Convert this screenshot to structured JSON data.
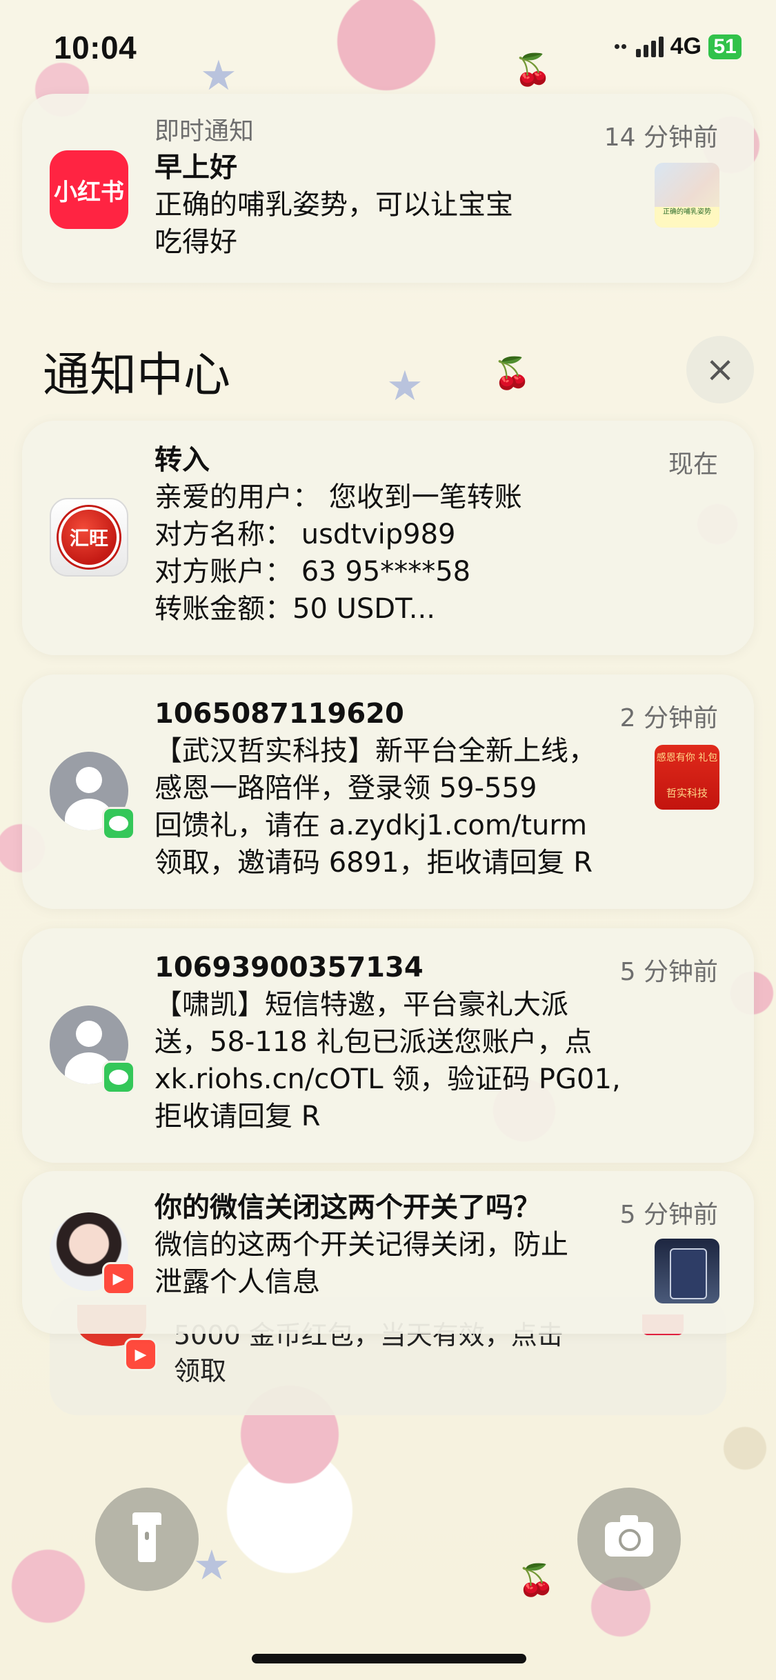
{
  "status_bar": {
    "time": "10:04",
    "network": "4G",
    "battery": "51"
  },
  "notification_center": {
    "title": "通知中心",
    "close_glyph": "×"
  },
  "notifications": [
    {
      "app_label": "即时通知",
      "title": "早上好",
      "body": "正确的哺乳姿势，可以让宝宝\n吃得好",
      "time": "14 分钟前",
      "icon": "xiaohongshu-icon",
      "icon_text": "小红书",
      "thumb_caption": "正确的哺乳姿势"
    },
    {
      "title": "转入",
      "body": "亲爱的用户： 您收到一笔转账\n对方名称： usdtvip989\n对方账户： 63 95****58\n转账金额：50 USDT...",
      "time": "现在",
      "icon": "huiwang-icon",
      "icon_text": "汇旺"
    },
    {
      "title": "1065087119620",
      "body": "【武汉哲实科技】新平台全新上线，\n感恩一路陪伴，登录领 59-559\n回馈礼，请在 a.zydkj1.com/turm\n领取，邀请码 6891，拒收请回复 R",
      "time": "2 分钟前",
      "icon": "contact-avatar-icon",
      "badge": "messages-icon",
      "thumb_caption_top": "感恩有你 礼包",
      "thumb_caption_bottom": "哲实科技"
    },
    {
      "title": "10693900357134",
      "body": "【啸凯】短信特邀，平台豪礼大派\n送，58-118 礼包已派送您账户，点\nxk.riohs.cn/cOTL 领，验证码 PG01,\n拒收请回复 R",
      "time": "5 分钟前",
      "icon": "contact-avatar-icon",
      "badge": "messages-icon"
    },
    {
      "title": "你的微信关闭这两个开关了吗？",
      "body": "微信的这两个开关记得关闭，防止\n泄露个人信息",
      "time": "5 分钟前",
      "icon": "profile-photo-icon",
      "badge": "kuaishou-icon"
    }
  ],
  "stacked_notification": {
    "body_peek": "5000 金币红包，当天有效，点击\n领取"
  },
  "lock_screen": {
    "flashlight_icon": "flashlight-icon",
    "camera_icon": "camera-icon"
  },
  "colors": {
    "xiaohongshu": "#ff2442",
    "messages_badge": "#34c759",
    "battery": "#31c24a",
    "card_background": "#f4f3e8"
  }
}
